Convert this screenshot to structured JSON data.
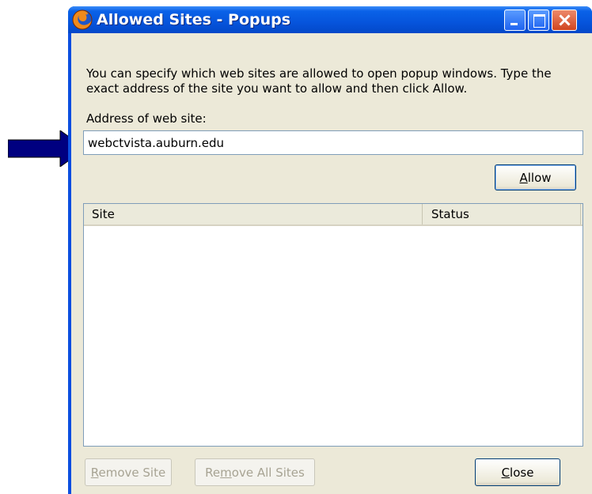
{
  "window": {
    "title": "Allowed Sites - Popups"
  },
  "description": "You can specify which web sites are allowed to open popup windows. Type the exact address of the site you want to allow and then click Allow.",
  "address": {
    "label": "Address of web site:",
    "value": "webctvista.auburn.edu"
  },
  "buttons": {
    "allow": {
      "mnemonic": "A",
      "rest": "llow"
    },
    "remove_site": {
      "mnemonic": "R",
      "rest": "emove Site",
      "enabled": false
    },
    "remove_all": {
      "pre": "Re",
      "mnemonic": "m",
      "rest": "ove All Sites",
      "enabled": false
    },
    "close": {
      "mnemonic": "C",
      "rest": "lose"
    }
  },
  "sites_table": {
    "columns": [
      "Site",
      "Status"
    ],
    "rows": []
  },
  "colors": {
    "titlebar": "#0654dc",
    "dialog_bg": "#ece9d8",
    "arrow": "#000080"
  },
  "icons": {
    "app": "firefox-icon",
    "pointer": "arrow-right-icon"
  }
}
